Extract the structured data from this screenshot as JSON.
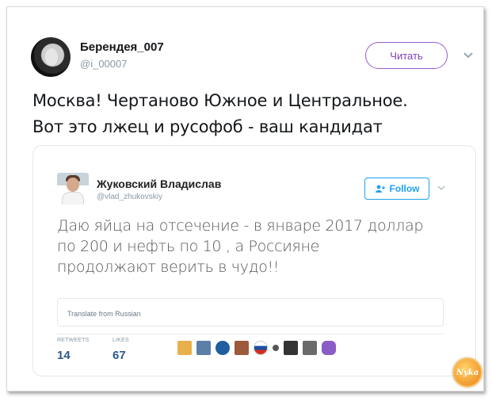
{
  "tweet": {
    "author_name": "Берендея_007",
    "author_handle": "@i_00007",
    "read_button_label": "Читать",
    "text_line1": "Москва! Чертаново Южное и Центральное.",
    "text_line2": "Вот это лжец и русофоб - ваш кандидат"
  },
  "quoted_tweet": {
    "author_name": "Жуковский Владислав",
    "author_handle": "@vlad_zhukovskiy",
    "follow_button_label": "Follow",
    "text_line1": "Даю яйца на отсечение - в январе 2017 доллар",
    "text_line2": "по 200 и нефть по 10 , а Россияне",
    "text_line3": "продолжают верить в чудо!!",
    "translate_label": "Translate from Russian",
    "retweets_label": "RETWEETS",
    "retweets_value": "14",
    "likes_label": "LIKES",
    "likes_value": "67"
  },
  "icons": {
    "chevron": "chevron-down-icon",
    "follow": "add-user-icon"
  },
  "colors": {
    "read_button": "#7d3fb8",
    "follow_button": "#1da1f2",
    "stat_value": "#2c5a8a"
  }
}
